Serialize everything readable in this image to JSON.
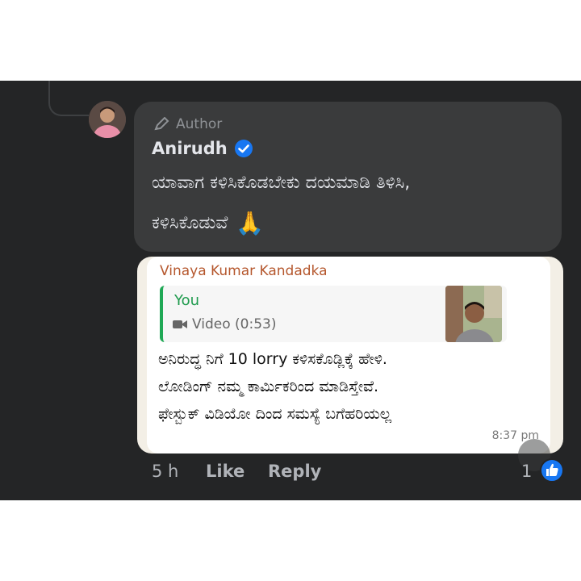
{
  "comment": {
    "author_badge": "Author",
    "author_name": "Anirudh",
    "message_line1": "ಯಾವಾಗ ಕಳಿಸಿಕೊಡಬೇಕು ದಯಮಾಡಿ ತಿಳಿಸಿ,",
    "message_line2": "ಕಳಿಸಿಕೊಡುವೆ",
    "emoji": "🙏"
  },
  "attachment": {
    "sender": "Vinaya Kumar Kandadka",
    "quoted_from": "You",
    "quoted_media": "Video (0:53)",
    "lines": [
      "ಅನಿರುದ್ಧ ನಿಗೆ 10 lorry ಕಳಿಸಕೊಡ್ಲಿಕ್ಕೆ ಹೇಳಿ.",
      "ಲೋಡಿಂಗ್ ನಮ್ಮ ಕಾರ್ಮಿಕರಿಂದ ಮಾಡಿಸ್ತೇವೆ.",
      "ಫೇಸ್ಬುಕ್ ವಿಡಿಯೋ ದಿಂದ ಸಮಸ್ಯೆ ಬಗೆಹರಿಯಲ್ಲ"
    ],
    "time": "8:37 pm"
  },
  "footer": {
    "time_ago": "5 h",
    "like_label": "Like",
    "reply_label": "Reply",
    "reaction_count": "1"
  },
  "colors": {
    "background": "#242526",
    "bubble": "#3a3b3c",
    "text": "#e4e6eb",
    "muted": "#b0b3b8",
    "verified_blue": "#1877f2",
    "whatsapp_green": "#1fa855",
    "sender_orange": "#b5572d"
  },
  "icons": {
    "author": "pencil-icon",
    "verified": "verified-badge-icon",
    "video": "video-camera-icon",
    "reaction": "thumbs-up-icon"
  }
}
